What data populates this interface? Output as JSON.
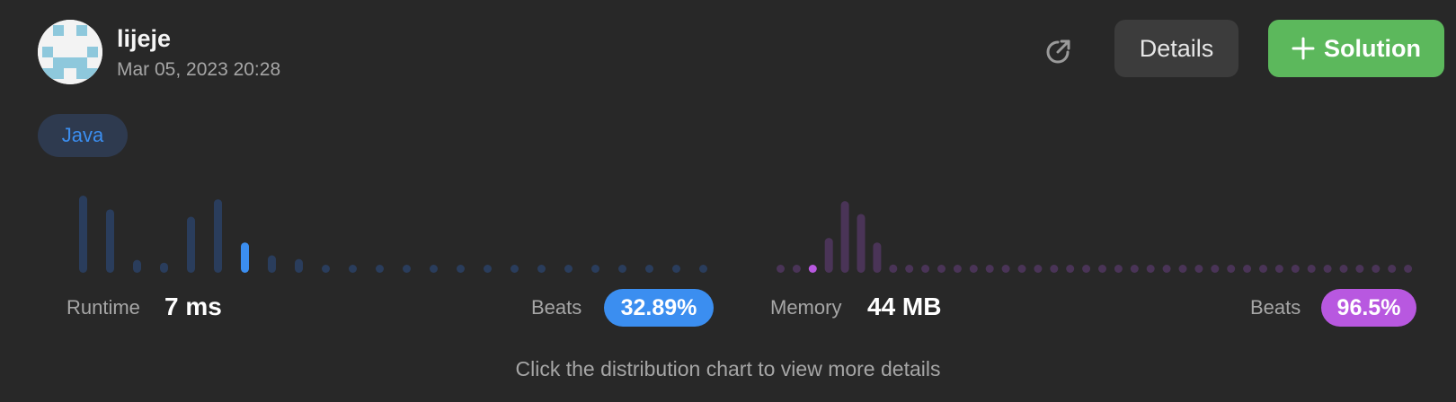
{
  "user": {
    "name": "lijeje",
    "date": "Mar 05, 2023 20:28",
    "avatar_icon": "identicon"
  },
  "header": {
    "refresh_icon": "share-arrow-icon",
    "details_label": "Details",
    "solution_label": "Solution",
    "solution_icon": "plus-icon"
  },
  "language": "Java",
  "colors": {
    "accent_blue": "#3b8ef0",
    "accent_purple": "#b858e0",
    "solution_green": "#5cb85c",
    "background": "#282828"
  },
  "runtime": {
    "label": "Runtime",
    "value": "7 ms",
    "beats_label": "Beats",
    "beats": "32.89%"
  },
  "memory": {
    "label": "Memory",
    "value": "44 MB",
    "beats_label": "Beats",
    "beats": "96.5%"
  },
  "hint": "Click the distribution chart to view more details",
  "chart_data": [
    {
      "type": "bar",
      "name": "runtime-distribution",
      "values": [
        84,
        69,
        14,
        11,
        61,
        80,
        33,
        19,
        15,
        7,
        8,
        5,
        5,
        5,
        5,
        5,
        5,
        5,
        5,
        5,
        5,
        5,
        5,
        5,
        5
      ],
      "highlight_index": 6,
      "ylim": [
        0,
        84
      ]
    },
    {
      "type": "bar",
      "name": "memory-distribution",
      "values": [
        4,
        4,
        6,
        38,
        78,
        64,
        33,
        9,
        5,
        5,
        5,
        5,
        5,
        5,
        5,
        5,
        5,
        5,
        5,
        5,
        5,
        5,
        5,
        5,
        5,
        5,
        5,
        5,
        5,
        5,
        5,
        5,
        5,
        5,
        5,
        5,
        5,
        5,
        5,
        5
      ],
      "highlight_index": 2,
      "ylim": [
        0,
        84
      ]
    }
  ]
}
